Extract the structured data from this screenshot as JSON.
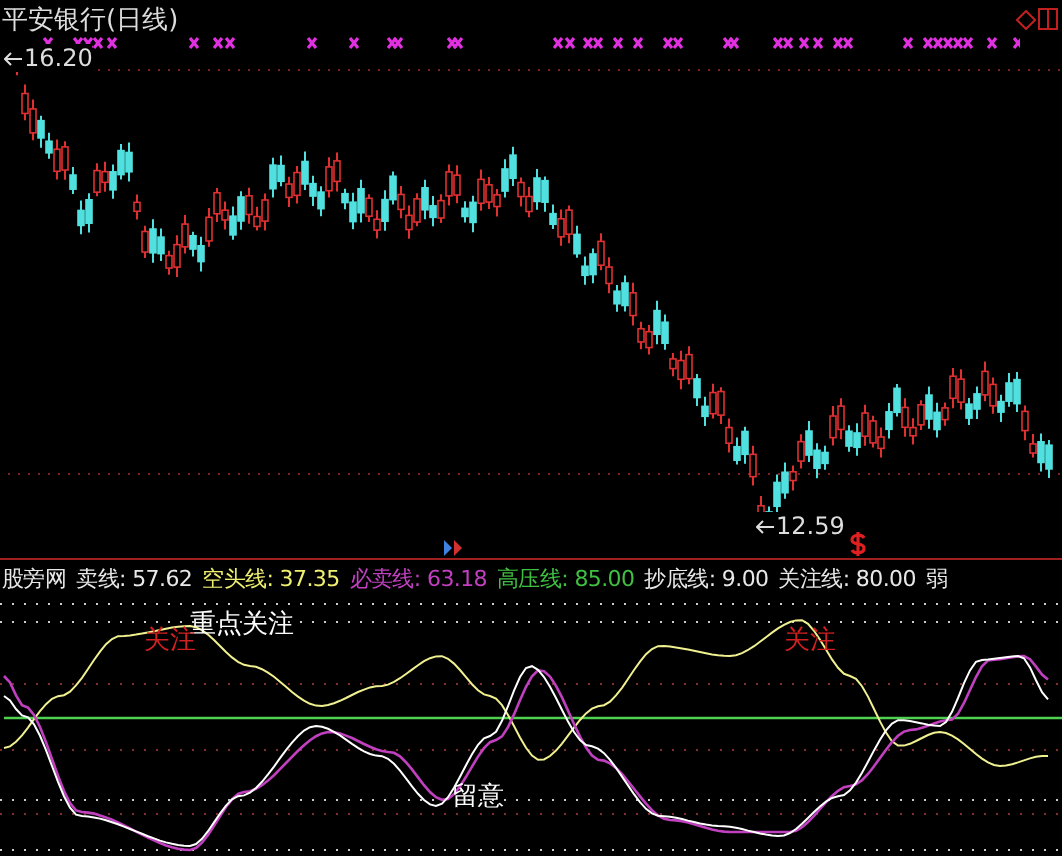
{
  "title": "平安银行(日线)",
  "price_chart": {
    "high_label": "16.20",
    "low_label": "12.59"
  },
  "indicator": {
    "name": "股旁网",
    "strength": "弱",
    "values": [
      {
        "label": "卖线:",
        "value": "57.62",
        "color": "#e8e8e8"
      },
      {
        "label": "空头线:",
        "value": "37.35",
        "color": "#f0f070"
      },
      {
        "label": "必卖线:",
        "value": "63.18",
        "color": "#c040c0"
      },
      {
        "label": "高压线:",
        "value": "85.00",
        "color": "#40c040"
      },
      {
        "label": "抄底线:",
        "value": "9.00",
        "color": "#e8e8e8"
      },
      {
        "label": "关注线:",
        "value": "80.00",
        "color": "#e8e8e8"
      }
    ]
  },
  "annotations": [
    {
      "text": "重点关注",
      "color": "#ffffff"
    },
    {
      "text": "关注",
      "color": "#d02020"
    },
    {
      "text": "关注",
      "color": "#d02020"
    },
    {
      "text": "留意",
      "color": "#ffffff"
    }
  ]
}
